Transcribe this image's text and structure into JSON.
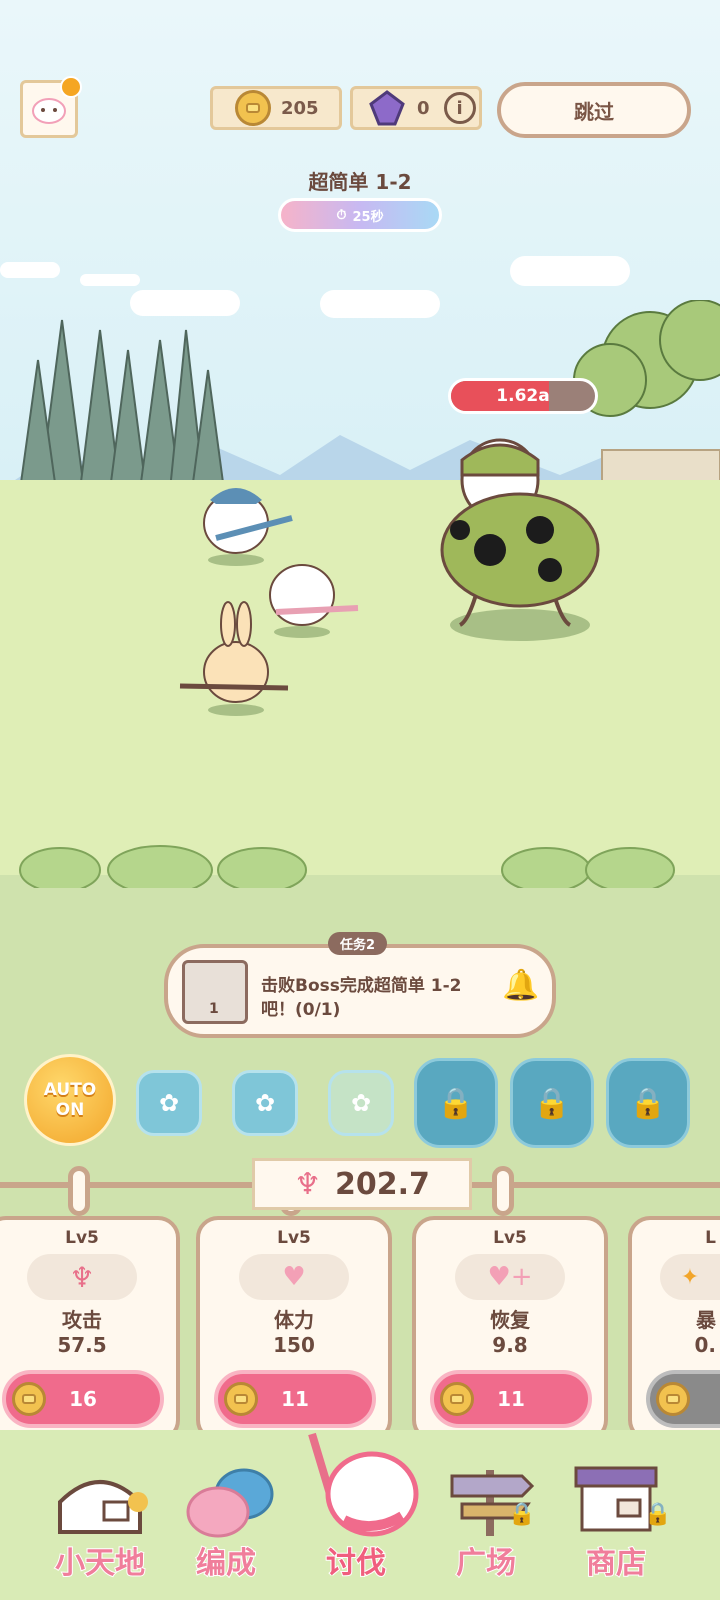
{
  "hud": {
    "coins": "205",
    "gems": "0",
    "skip_label": "跳过"
  },
  "stage": {
    "name": "超简单 1-2",
    "timer": "25秒"
  },
  "boss": {
    "hp_text": "1.62a",
    "hp_fraction": 0.68
  },
  "task": {
    "badge": "任务2",
    "icon_count": "1",
    "text": "击败Boss完成超简单 1-2吧！(0/1)"
  },
  "auto": {
    "line1": "AUTO",
    "line2": "ON"
  },
  "power": "202.7",
  "upgrades": [
    {
      "level": "Lv5",
      "name": "攻击",
      "value": "57.5",
      "cost": "16"
    },
    {
      "level": "Lv5",
      "name": "体力",
      "value": "150",
      "cost": "11"
    },
    {
      "level": "Lv5",
      "name": "恢复",
      "value": "9.8",
      "cost": "11"
    },
    {
      "level": "L",
      "name": "暴",
      "value": "0.",
      "cost": ""
    }
  ],
  "nav": [
    {
      "label": "小天地",
      "icon": "house-icon"
    },
    {
      "label": "编成",
      "icon": "team-icon"
    },
    {
      "label": "讨伐",
      "icon": "battle-icon"
    },
    {
      "label": "广场",
      "icon": "signpost-icon"
    },
    {
      "label": "商店",
      "icon": "shop-icon"
    }
  ],
  "colors": {
    "accent_pink": "#f06b8c",
    "panel": "#fff8ee",
    "border": "#c9a58b",
    "hp_red": "#e8505a",
    "auto_orange": "#f2a52a"
  }
}
